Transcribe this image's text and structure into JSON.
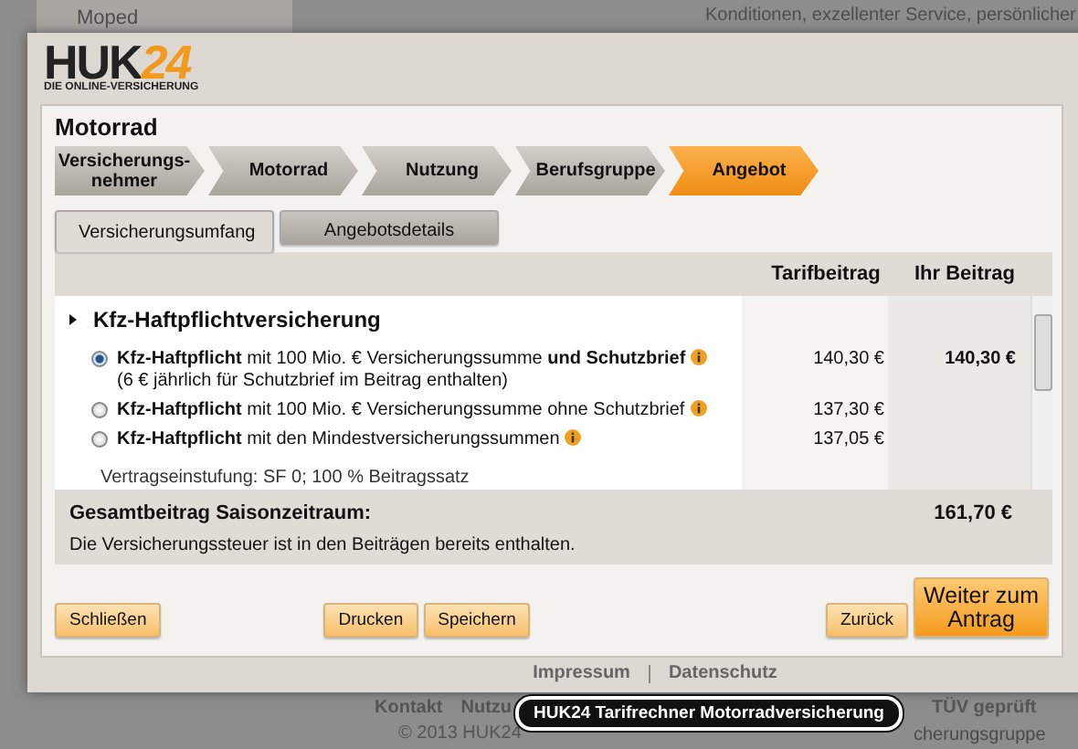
{
  "background": {
    "menu_item": "Moped",
    "intro_text": "Konditionen, exzellenter Service, persönlicher",
    "footer_links": [
      "Kontakt",
      "Nutzu",
      "TÜV geprüft"
    ],
    "copyright": "© 2013 HUK24",
    "copyright_tail": "cherungsgruppe"
  },
  "logo": {
    "name": "HUK",
    "number": "24",
    "tagline": "DIE ONLINE-VERSICHERUNG"
  },
  "dialog": {
    "title": "Motorrad",
    "steps": [
      {
        "label": "Versicherungs-\nnehmer",
        "selected": false
      },
      {
        "label": "Motorrad",
        "selected": false
      },
      {
        "label": "Nutzung",
        "selected": false
      },
      {
        "label": "Berufsgruppe",
        "selected": false
      },
      {
        "label": "Angebot",
        "selected": true
      }
    ],
    "tabs": [
      {
        "label": "Versicherungsumfang",
        "selected": true
      },
      {
        "label": "Angebotsdetails",
        "selected": false
      }
    ],
    "table": {
      "columns": [
        "Tarifbeitrag",
        "Ihr Beitrag"
      ],
      "section": "Kfz-Haftpflichtversicherung",
      "rows": [
        {
          "kind": "radio",
          "selected": true,
          "text": "**Kfz-Haftpflicht** mit 100 Mio. € Versicherungssumme **und Schutzbrief**",
          "note": "(6 € jährlich für Schutzbrief im Beitrag enthalten)",
          "tarif": "140,30 €",
          "yours": "140,30 €"
        },
        {
          "kind": "radio",
          "selected": false,
          "text": "**Kfz-Haftpflicht** mit 100 Mio. € Versicherungssumme ohne Schutzbrief",
          "tarif": "137,30 €"
        },
        {
          "kind": "radio",
          "selected": false,
          "text": "**Kfz-Haftpflicht** mit den Mindestversicherungssummen",
          "tarif": "137,05 €"
        },
        {
          "kind": "plain",
          "text": "Vertragseinstufung: SF 0; 100 % Beitragssatz"
        }
      ],
      "total_label": "Gesamtbeitrag Saisonzeitraum:",
      "total": "161,70 €",
      "tax_note": "Die Versicherungssteuer ist in den Beiträgen bereits enthalten."
    },
    "buttons": [
      {
        "label": "Schließen",
        "kind": "left"
      },
      {
        "label": "Drucken",
        "kind": "middle"
      },
      {
        "label": "Speichern",
        "kind": "middle"
      },
      {
        "label": "Zurück",
        "kind": "right"
      },
      {
        "label": "Weiter zum Antrag",
        "kind": "primary"
      }
    ],
    "links": [
      "Impressum",
      "Datenschutz"
    ]
  },
  "tooltip": "HUK24 Tarifrechner Motorradversicherung"
}
